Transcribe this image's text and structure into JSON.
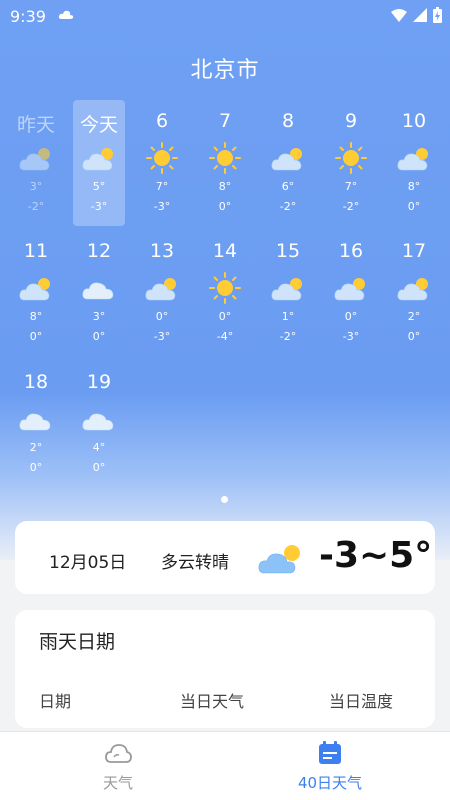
{
  "status_bar": {
    "time": "9:39",
    "icons": [
      "cloud-icon",
      "wifi-icon",
      "signal-icon",
      "battery-icon"
    ]
  },
  "header": {
    "city": "北京市"
  },
  "forecast_rows": [
    [
      {
        "label": "昨天",
        "icon": "partly-cloudy",
        "high": "3°",
        "low": "-2°",
        "state": "past"
      },
      {
        "label": "今天",
        "icon": "partly-cloudy",
        "high": "5°",
        "low": "-3°",
        "state": "today"
      },
      {
        "label": "6",
        "icon": "sunny",
        "high": "7°",
        "low": "-3°",
        "state": "future"
      },
      {
        "label": "7",
        "icon": "sunny",
        "high": "8°",
        "low": "0°",
        "state": "future"
      },
      {
        "label": "8",
        "icon": "partly-cloudy",
        "high": "6°",
        "low": "-2°",
        "state": "future"
      },
      {
        "label": "9",
        "icon": "sunny",
        "high": "7°",
        "low": "-2°",
        "state": "future"
      },
      {
        "label": "10",
        "icon": "partly-cloudy",
        "high": "8°",
        "low": "0°",
        "state": "future"
      }
    ],
    [
      {
        "label": "11",
        "icon": "partly-cloudy",
        "high": "8°",
        "low": "0°",
        "state": "future"
      },
      {
        "label": "12",
        "icon": "cloudy",
        "high": "3°",
        "low": "0°",
        "state": "future"
      },
      {
        "label": "13",
        "icon": "partly-cloudy",
        "high": "0°",
        "low": "-3°",
        "state": "future"
      },
      {
        "label": "14",
        "icon": "sunny",
        "high": "0°",
        "low": "-4°",
        "state": "future"
      },
      {
        "label": "15",
        "icon": "partly-cloudy",
        "high": "1°",
        "low": "-2°",
        "state": "future"
      },
      {
        "label": "16",
        "icon": "partly-cloudy",
        "high": "0°",
        "low": "-3°",
        "state": "future"
      },
      {
        "label": "17",
        "icon": "partly-cloudy",
        "high": "2°",
        "low": "0°",
        "state": "future"
      }
    ],
    [
      {
        "label": "18",
        "icon": "cloudy",
        "high": "2°",
        "low": "0°",
        "state": "future"
      },
      {
        "label": "19",
        "icon": "cloudy",
        "high": "4°",
        "low": "0°",
        "state": "future"
      }
    ]
  ],
  "today_card": {
    "date": "12月05日",
    "condition": "多云转晴",
    "icon": "partly-cloudy",
    "range": "-3~5°"
  },
  "rain_card": {
    "title": "雨天日期",
    "columns": [
      "日期",
      "当日天气",
      "当日温度"
    ]
  },
  "tabs": [
    {
      "label": "天气",
      "icon": "cloud-outline-icon",
      "active": false
    },
    {
      "label": "40日天气",
      "icon": "calendar-icon",
      "active": true
    }
  ],
  "colors": {
    "accent": "#3d7ff0",
    "sky": "#6a9cf2",
    "sun": "#ffcc33"
  }
}
